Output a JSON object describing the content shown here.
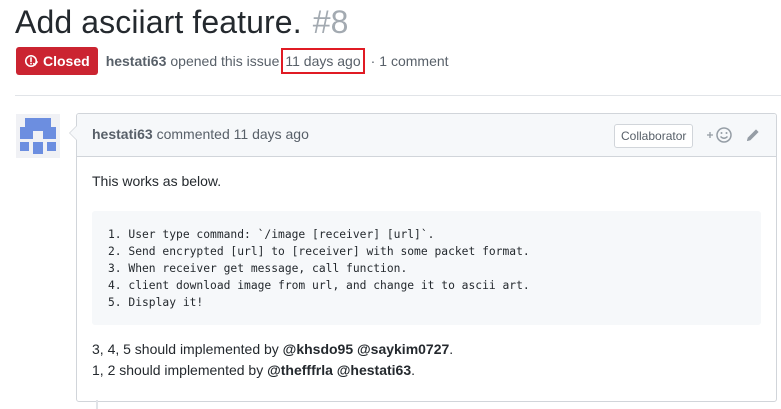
{
  "issue": {
    "title": "Add asciiart feature.",
    "number": "#8",
    "state": "Closed",
    "author": "hestati63",
    "opened_text": "opened this issue",
    "time_ago": "11 days ago",
    "separator": "·",
    "comments_count": "1 comment"
  },
  "comment": {
    "author": "hestati63",
    "action": "commented",
    "time_ago": "11 days ago",
    "role_badge": "Collaborator",
    "intro": "This works as below.",
    "code_lines": [
      "1. User type command: `/image [receiver] [url]`.",
      "2. Send encrypted [url] to [receiver] with some packet format.",
      "3. When receiver get message, call function.",
      "4. client download image from url, and change it to ascii art.",
      "5. Display it!"
    ],
    "line1_prefix": "3, 4, 5 should implemented by",
    "line1_mention1": "@khsdo95",
    "line1_mention2": "@saykim0727",
    "line2_prefix": "1, 2 should implemented by",
    "line2_mention1": "@thefffrla",
    "line2_mention2": "@hestati63",
    "period": "."
  },
  "colors": {
    "closed_red": "#cb2431",
    "highlight_red": "#e01b24",
    "avatar_blue": "#6c8ee0"
  }
}
